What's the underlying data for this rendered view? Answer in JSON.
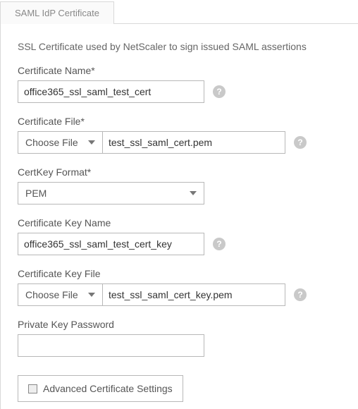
{
  "tab": {
    "label": "SAML IdP Certificate"
  },
  "panel": {
    "description": "SSL Certificate used by NetScaler to sign issued SAML assertions",
    "cert_name": {
      "label": "Certificate Name*",
      "value": "office365_ssl_saml_test_cert"
    },
    "cert_file": {
      "label": "Certificate File*",
      "choose_label": "Choose File",
      "value": "test_ssl_saml_cert.pem"
    },
    "cert_key_format": {
      "label": "CertKey Format*",
      "value": "PEM"
    },
    "cert_key_name": {
      "label": "Certificate Key Name",
      "value": "office365_ssl_saml_test_cert_key"
    },
    "cert_key_file": {
      "label": "Certificate Key File",
      "choose_label": "Choose File",
      "value": "test_ssl_saml_cert_key.pem"
    },
    "private_key_password": {
      "label": "Private Key Password",
      "value": ""
    },
    "advanced": {
      "label": "Advanced Certificate Settings",
      "checked": false
    }
  },
  "icons": {
    "help": "?"
  }
}
